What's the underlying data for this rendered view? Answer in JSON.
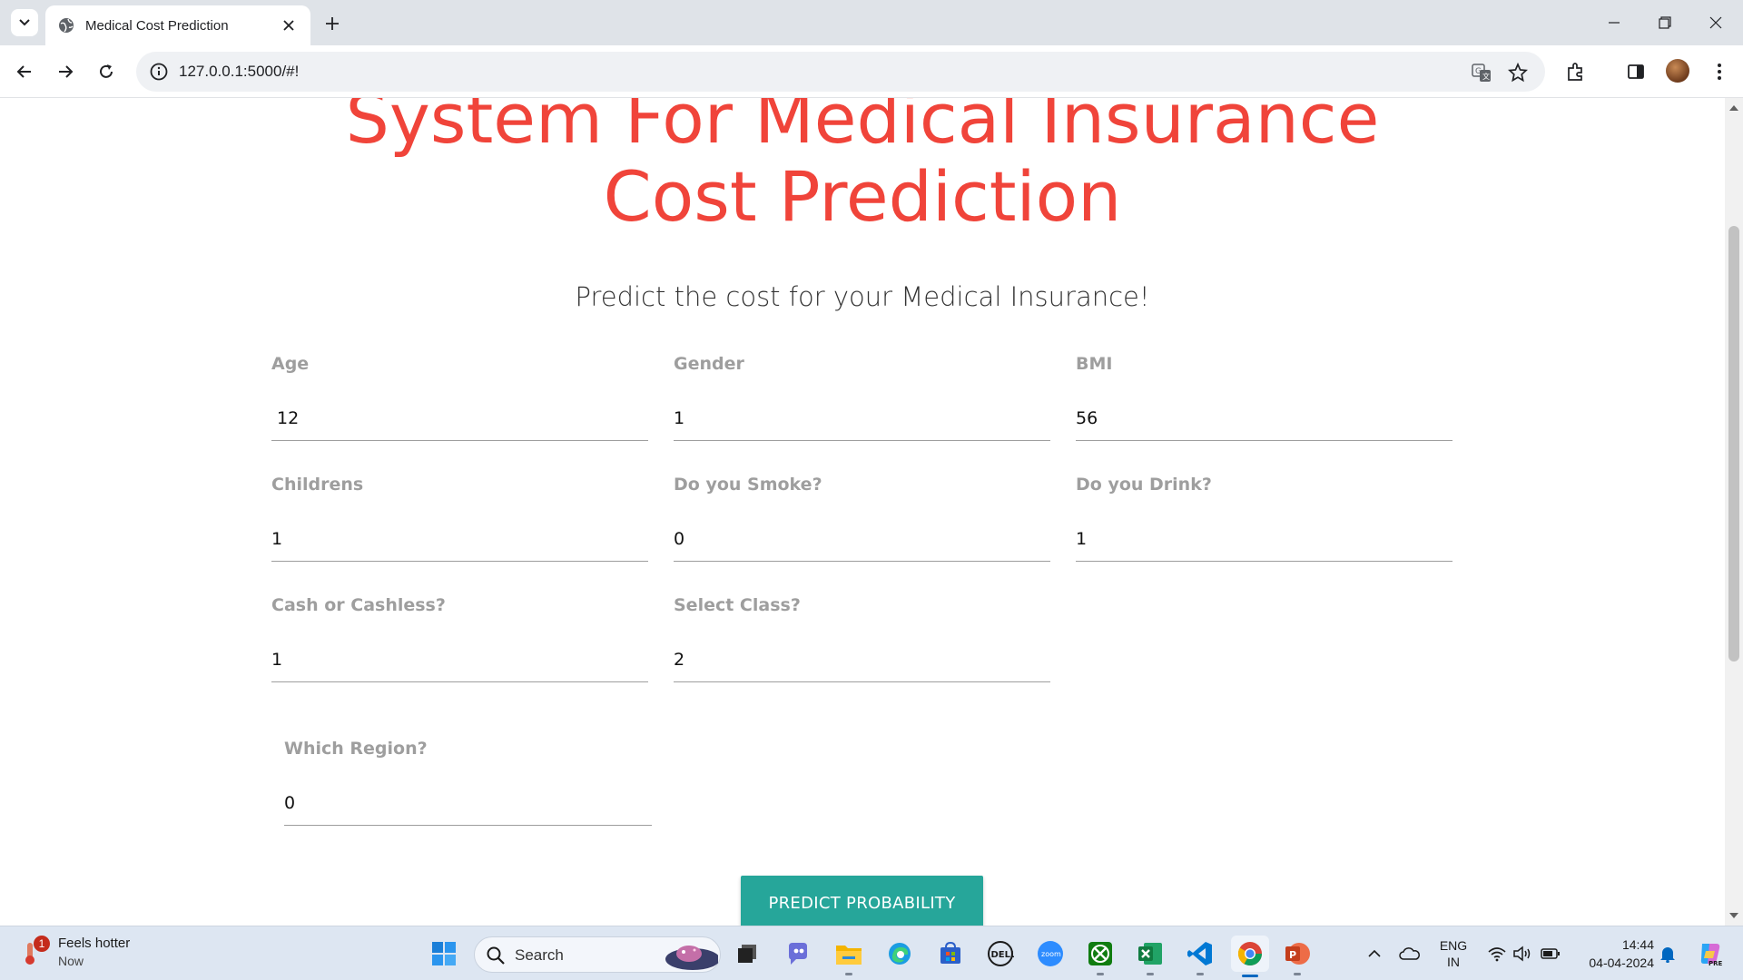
{
  "browser": {
    "tab_title": "Medical Cost Prediction",
    "url": "127.0.0.1:5000/#!"
  },
  "page": {
    "title": "System For Medical Insurance Cost Prediction",
    "subtitle": "Predict the cost for your Medical Insurance!",
    "fields": [
      {
        "label": "Age",
        "value": "12"
      },
      {
        "label": "Gender",
        "value": "1"
      },
      {
        "label": "BMI",
        "value": "56"
      },
      {
        "label": "Childrens",
        "value": "1"
      },
      {
        "label": "Do you Smoke?",
        "value": "0"
      },
      {
        "label": "Do you Drink?",
        "value": "1"
      },
      {
        "label": "Cash or Cashless?",
        "value": "1"
      },
      {
        "label": "Select Class?",
        "value": "2"
      },
      {
        "label": "Which Region?",
        "value": "0"
      }
    ],
    "predict_button": "PREDICT PROBABILITY"
  },
  "taskbar": {
    "weather_title": "Feels hotter",
    "weather_sub": "Now",
    "weather_badge": "1",
    "search_label": "Search",
    "lang_top": "ENG",
    "lang_bottom": "IN",
    "time": "14:44",
    "date": "04-04-2024",
    "apps": [
      "start-icon",
      "search",
      "task-view-icon",
      "teams-chat-icon",
      "file-explorer-icon",
      "edge-icon",
      "store-icon",
      "dell-icon",
      "zoom-icon",
      "xbox-icon",
      "excel-icon",
      "vscode-icon",
      "chrome-icon",
      "powerpoint-icon"
    ]
  },
  "colors": {
    "title": "#f0443a",
    "button": "#26a69a",
    "label": "#9e9e9e"
  }
}
